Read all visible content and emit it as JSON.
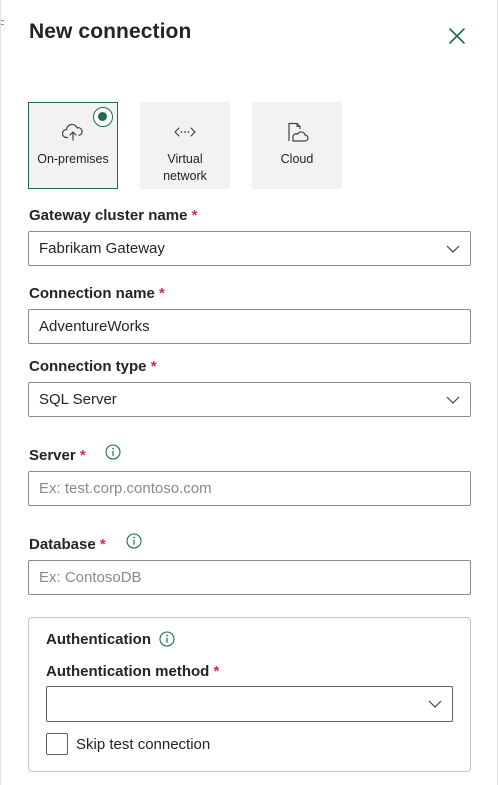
{
  "header": {
    "title": "New connection",
    "close_icon": "close-icon"
  },
  "connection_modes": [
    {
      "label": "On-premises",
      "icon": "cloud-upload-icon",
      "selected": true
    },
    {
      "label": "Virtual network",
      "icon": "virtual-network-icon",
      "selected": false
    },
    {
      "label": "Cloud",
      "icon": "cloud-document-icon",
      "selected": false
    }
  ],
  "gateway": {
    "label": "Gateway cluster name",
    "required_mark": "*",
    "value": "Fabrikam Gateway"
  },
  "connection_name": {
    "label": "Connection name",
    "required_mark": "*",
    "value": "AdventureWorks"
  },
  "connection_type": {
    "label": "Connection type",
    "required_mark": "*",
    "value": "SQL Server"
  },
  "server": {
    "label": "Server",
    "required_mark": "*",
    "placeholder": "Ex: test.corp.contoso.com",
    "value": ""
  },
  "database": {
    "label": "Database",
    "required_mark": "*",
    "placeholder": "Ex: ContosoDB",
    "value": ""
  },
  "authentication": {
    "title": "Authentication",
    "method_label": "Authentication method",
    "required_mark": "*",
    "method_value": "",
    "skip_test_label": "Skip test connection",
    "skip_test_checked": false
  },
  "colors": {
    "accent": "#1f6b52",
    "required": "#c4314b",
    "tile_bg": "#f3f2f1",
    "border": "#8a8a8a",
    "placeholder": "#8a8a8a"
  }
}
